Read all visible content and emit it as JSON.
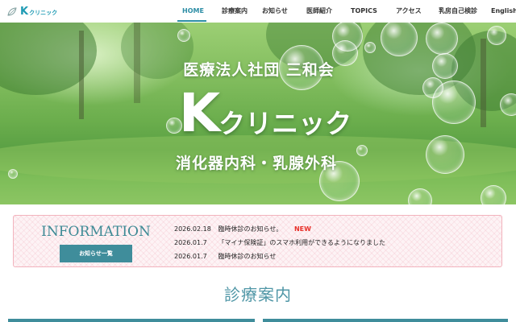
{
  "brand": {
    "logo_letter": "K",
    "logo_kana": "クリニック",
    "accent_color": "#2e8ea6"
  },
  "nav": {
    "items": [
      {
        "label": "HOME"
      },
      {
        "label": "診療案内"
      },
      {
        "label": "お知らせ"
      },
      {
        "label": "医師紹介"
      },
      {
        "label": "TOPICS"
      },
      {
        "label": "アクセス"
      },
      {
        "label": "乳房自己検診"
      },
      {
        "label": "English"
      }
    ],
    "active": "HOME"
  },
  "hero": {
    "organization": "医療法人社団 三和会",
    "name_letter": "K",
    "name_kana": "クリニック",
    "departments": "消化器内科・乳腺外科"
  },
  "information": {
    "title": "INFORMATION",
    "button_label": "お知らせ一覧",
    "news": [
      {
        "date": "2026.02.18",
        "text": "臨時休診のお知らせ。",
        "badge": "NEW"
      },
      {
        "date": "2026.01.7",
        "text": "「マイナ保険証」のスマホ利用ができるようになりました",
        "badge": ""
      },
      {
        "date": "2026.01.7",
        "text": "臨時休診のお知らせ",
        "badge": ""
      }
    ]
  },
  "section": {
    "title": "診療案内"
  },
  "icons": {
    "logo": "leaf-logo-icon"
  },
  "colors": {
    "info_border": "#f2b3bd",
    "info_button": "#3f8d9b",
    "badge_new": "#e8312a"
  }
}
